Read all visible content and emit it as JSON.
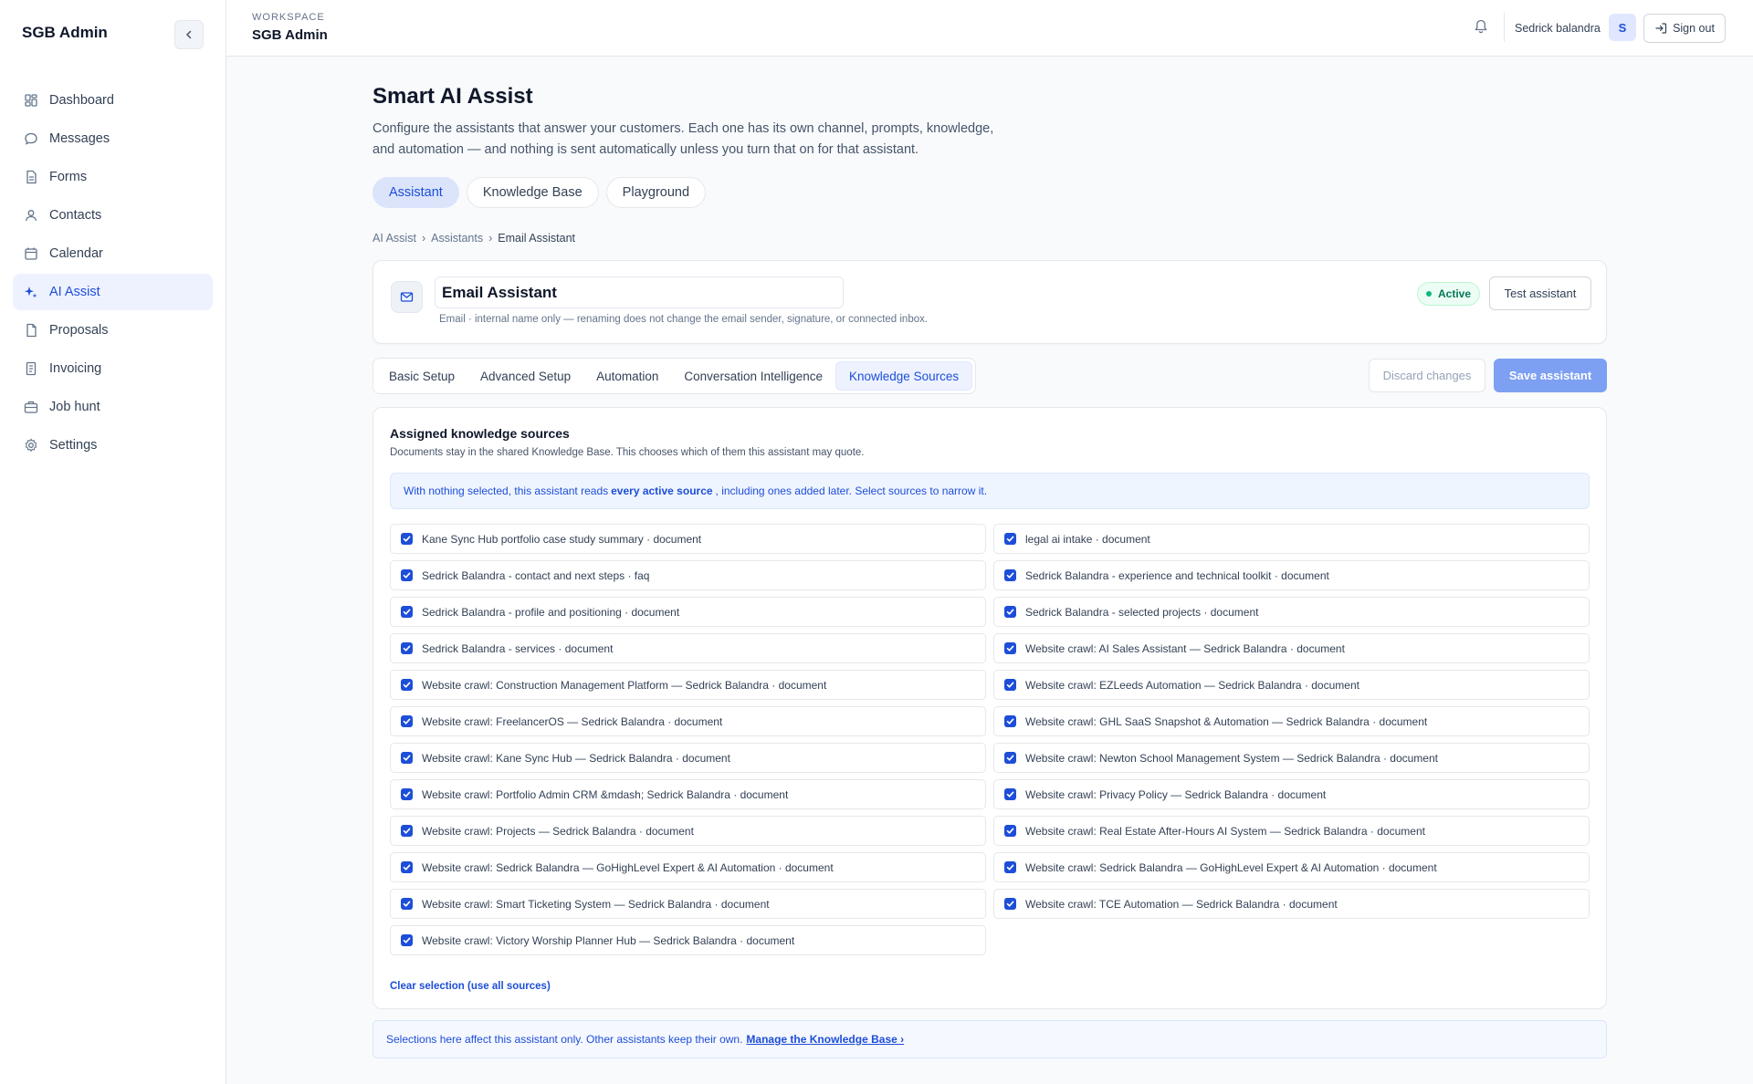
{
  "sidebar": {
    "brand": "SGB Admin",
    "items": [
      {
        "label": "Dashboard",
        "icon": "dashboard-icon"
      },
      {
        "label": "Messages",
        "icon": "messages-icon"
      },
      {
        "label": "Forms",
        "icon": "forms-icon"
      },
      {
        "label": "Contacts",
        "icon": "contacts-icon"
      },
      {
        "label": "Calendar",
        "icon": "calendar-icon"
      },
      {
        "label": "AI Assist",
        "icon": "sparkles-icon",
        "active": true
      },
      {
        "label": "Proposals",
        "icon": "proposals-icon"
      },
      {
        "label": "Invoicing",
        "icon": "invoicing-icon"
      },
      {
        "label": "Job hunt",
        "icon": "briefcase-icon"
      },
      {
        "label": "Settings",
        "icon": "gear-icon"
      }
    ]
  },
  "topbar": {
    "workspace_label": "WORKSPACE",
    "workspace_name": "SGB Admin",
    "user_name": "Sedrick balandra",
    "avatar_initial": "S",
    "signout_label": "Sign out"
  },
  "page": {
    "title": "Smart AI Assist",
    "description": "Configure the assistants that answer your customers. Each one has its own channel, prompts, knowledge, and automation — and nothing is sent automatically unless you turn that on for that assistant.",
    "tabs": [
      {
        "label": "Assistant",
        "active": true
      },
      {
        "label": "Knowledge Base"
      },
      {
        "label": "Playground"
      }
    ],
    "breadcrumb": [
      "AI Assist",
      "Assistants",
      "Email Assistant"
    ]
  },
  "assistant": {
    "name": "Email Assistant",
    "hint": "Email · internal name only — renaming does not change the email sender, signature, or connected inbox.",
    "status": "Active",
    "test_label": "Test assistant"
  },
  "subtabs": [
    {
      "label": "Basic Setup"
    },
    {
      "label": "Advanced Setup"
    },
    {
      "label": "Automation"
    },
    {
      "label": "Conversation Intelligence"
    },
    {
      "label": "Knowledge Sources",
      "active": true
    }
  ],
  "actions": {
    "discard_label": "Discard changes",
    "save_label": "Save assistant"
  },
  "knowledge": {
    "title": "Assigned knowledge sources",
    "description": "Documents stay in the shared Knowledge Base. This chooses which of them this assistant may quote.",
    "info_pre": "With nothing selected, this assistant reads",
    "info_bold": "every active source",
    "info_post": ", including ones added later. Select sources to narrow it.",
    "sources": [
      "Kane Sync Hub portfolio case study summary · document",
      "legal ai intake · document",
      "Sedrick Balandra - contact and next steps · faq",
      "Sedrick Balandra - experience and technical toolkit · document",
      "Sedrick Balandra - profile and positioning · document",
      "Sedrick Balandra - selected projects · document",
      "Sedrick Balandra - services · document",
      "Website crawl: AI Sales Assistant — Sedrick Balandra · document",
      "Website crawl: Construction Management Platform — Sedrick Balandra · document",
      "Website crawl: EZLeeds Automation — Sedrick Balandra · document",
      "Website crawl: FreelancerOS — Sedrick Balandra · document",
      "Website crawl: GHL SaaS Snapshot & Automation — Sedrick Balandra · document",
      "Website crawl: Kane Sync Hub — Sedrick Balandra · document",
      "Website crawl: Newton School Management System — Sedrick Balandra · document",
      "Website crawl: Portfolio Admin CRM &mdash; Sedrick Balandra · document",
      "Website crawl: Privacy Policy — Sedrick Balandra · document",
      "Website crawl: Projects — Sedrick Balandra · document",
      "Website crawl: Real Estate After-Hours AI System — Sedrick Balandra · document",
      "Website crawl: Sedrick Balandra — GoHighLevel Expert & AI Automation · document",
      "Website crawl: Sedrick Balandra — GoHighLevel Expert & AI Automation · document",
      "Website crawl: Smart Ticketing System — Sedrick Balandra · document",
      "Website crawl: TCE Automation — Sedrick Balandra · document",
      "Website crawl: Victory Worship Planner Hub — Sedrick Balandra · document"
    ],
    "clear_label": "Clear selection (use all sources)"
  },
  "footer": {
    "note": "Selections here affect this assistant only. Other assistants keep their own.",
    "link": "Manage the Knowledge Base ›"
  },
  "colors": {
    "accent": "#1d4ed8",
    "save_button": "#7da0f2",
    "active_green": "#10b981"
  }
}
